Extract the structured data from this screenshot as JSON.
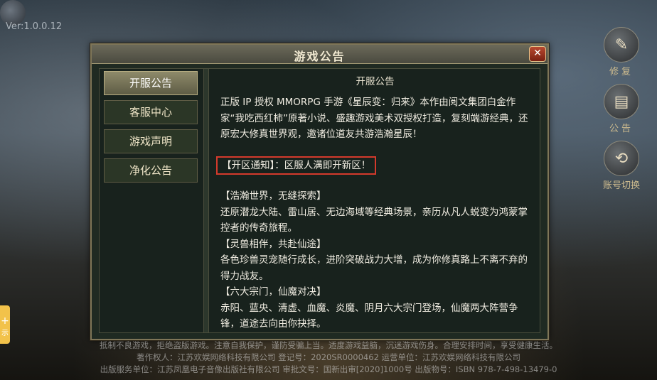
{
  "version": "Ver:1.0.0.12",
  "side_buttons": [
    {
      "label": "修复",
      "icon": "repair-icon"
    },
    {
      "label": "公告",
      "icon": "announcement-icon"
    },
    {
      "label": "账号切换",
      "icon": "account-switch-icon"
    }
  ],
  "left_tab": {
    "text": "示"
  },
  "dialog": {
    "title": "游戏公告",
    "close_label": "✕",
    "nav": [
      {
        "label": "开服公告",
        "active": true
      },
      {
        "label": "客服中心",
        "active": false
      },
      {
        "label": "游戏声明",
        "active": false
      },
      {
        "label": "净化公告",
        "active": false
      }
    ],
    "content_title": "开服公告",
    "intro": "正版 IP 授权 MMORPG 手游《星辰变：归来》本作由阅文集团白金作家“我吃西红柿”原著小说、盛趣游戏美术双授权打造，复刻端游经典，还原宏大修真世界观，邀诸位道友共游浩瀚星辰！",
    "notice": "【开区通知】：区服人满即开新区！",
    "sec1_title": "【浩瀚世界，无缝探索】",
    "sec1_body": "还原潜龙大陆、雷山居、无边海域等经典场景，亲历从凡人蜕变为鸿蒙掌控者的传奇旅程。",
    "sec2_title": "【灵兽相伴，共赴仙途】",
    "sec2_body": "各色珍兽灵宠随行成长，进阶突破战力大增，成为你修真路上不离不弃的得力战友。",
    "sec3_title": "【六大宗门，仙魔对决】",
    "sec3_body": "赤阳、蓝央、清虚、血魔、炎魔、阴月六大宗门登场，仙魔两大阵营争锋，道途去向由你抉择。"
  },
  "footer": {
    "line1": "抵制不良游戏，拒绝盗版游戏。注意自我保护，谨防受骗上当。适度游戏益脑，沉迷游戏伤身。合理安排时间，享受健康生活。",
    "line2": "著作权人：江苏欢娱网络科技有限公司 登记号：2020SR0000462 运营单位：江苏欢娱网络科技有限公司",
    "line3": "出版服务单位：江苏凤凰电子音像出版社有限公司 审批文号：国新出审[2020]1000号 出版物号：ISBN 978-7-498-13479-0"
  }
}
